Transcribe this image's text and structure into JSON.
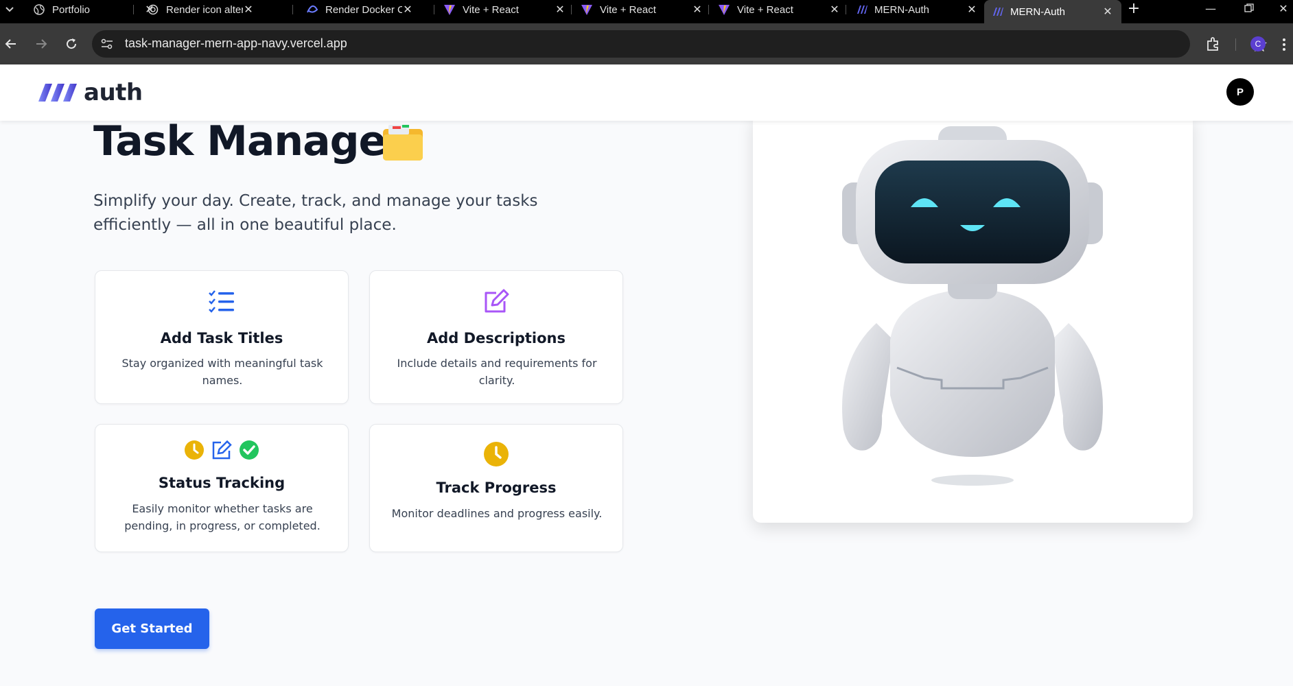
{
  "browser": {
    "tabs": [
      {
        "title": "Portfolio",
        "icon": "globe-icon",
        "active": false
      },
      {
        "title": "Render icon alter",
        "icon": "openai-icon",
        "active": false
      },
      {
        "title": "Render Docker C",
        "icon": "claude-icon",
        "active": false
      },
      {
        "title": "Vite + React",
        "icon": "vite-icon",
        "active": false
      },
      {
        "title": "Vite + React",
        "icon": "vite-icon",
        "active": false
      },
      {
        "title": "Vite + React",
        "icon": "vite-icon",
        "active": false
      },
      {
        "title": "MERN-Auth",
        "icon": "auth-logo-icon",
        "active": false
      },
      {
        "title": "MERN-Auth",
        "icon": "auth-logo-icon",
        "active": true
      }
    ],
    "url": "task-manager-mern-app-navy.vercel.app",
    "profile_initial": "C"
  },
  "header": {
    "logo_text": "auth",
    "avatar_initial": "P"
  },
  "hero": {
    "title": "Task Manager",
    "subtitle": "Simplify your day. Create, track, and manage your tasks efficiently — all in one beautiful place."
  },
  "features": [
    {
      "title": "Add Task Titles",
      "description": "Stay organized with meaningful task names.",
      "icon": "checklist-icon"
    },
    {
      "title": "Add Descriptions",
      "description": "Include details and requirements for clarity.",
      "icon": "edit-icon"
    },
    {
      "title": "Status Tracking",
      "description": "Easily monitor whether tasks are pending, in progress, or completed.",
      "icon": "status-icons"
    },
    {
      "title": "Track Progress",
      "description": "Monitor deadlines and progress easily.",
      "icon": "clock-icon"
    }
  ],
  "cta": {
    "label": "Get Started"
  },
  "colors": {
    "primary": "#2563eb",
    "purple": "#a855f7",
    "yellow": "#eab308",
    "green": "#22c55e"
  }
}
